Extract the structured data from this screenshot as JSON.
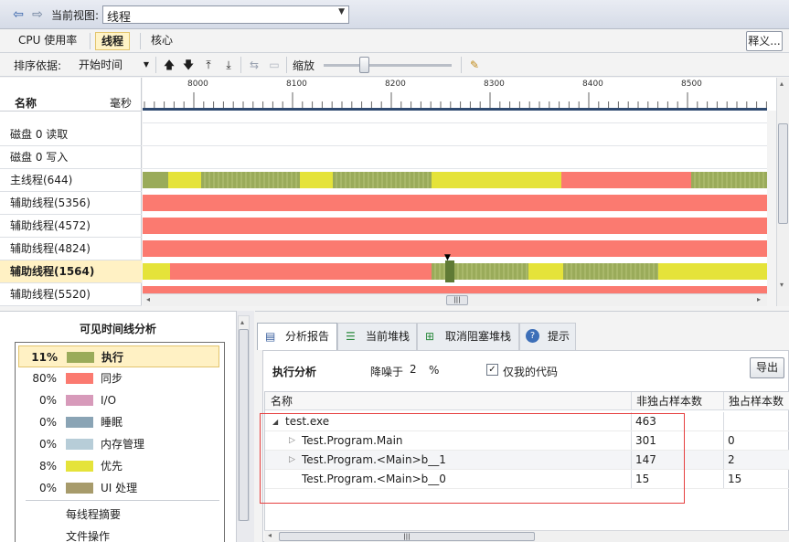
{
  "topbar": {
    "back_icon": "back-arrow-icon",
    "forward_icon": "forward-arrow-icon",
    "view_label": "当前视图:",
    "view_value": "线程"
  },
  "tabs": [
    {
      "label": "CPU 使用率"
    },
    {
      "label": "线程"
    },
    {
      "label": "核心"
    }
  ],
  "notes_button": "释义...",
  "toolbar": {
    "sort_label": "排序依据:",
    "sort_value": "开始时间",
    "zoom_label": "缩放"
  },
  "timeline": {
    "name_header": "名称",
    "ms_header": "毫秒",
    "ticks": [
      "8000",
      "8100",
      "8200",
      "8300",
      "8400",
      "8500"
    ],
    "rows": [
      {
        "label": "磁盘 0 读取"
      },
      {
        "label": "磁盘 0 写入"
      },
      {
        "label": "主线程(644)"
      },
      {
        "label": "辅助线程(5356)"
      },
      {
        "label": "辅助线程(4572)"
      },
      {
        "label": "辅助线程(4824)"
      },
      {
        "label": "辅助线程(1564)"
      },
      {
        "label": "辅助线程(5520)"
      }
    ]
  },
  "legend": {
    "title": "可见时间线分析",
    "items": [
      {
        "pct": "11%",
        "label": "执行",
        "color": "#9aab5a"
      },
      {
        "pct": "80%",
        "label": "同步",
        "color": "#fb7a70"
      },
      {
        "pct": "0%",
        "label": "I/O",
        "color": "#d79aba"
      },
      {
        "pct": "0%",
        "label": "睡眠",
        "color": "#8aa4b5"
      },
      {
        "pct": "0%",
        "label": "内存管理",
        "color": "#b7cdd8"
      },
      {
        "pct": "8%",
        "label": "优先",
        "color": "#e5e33a"
      },
      {
        "pct": "0%",
        "label": "UI 处理",
        "color": "#a79b6b"
      }
    ],
    "links": [
      "每线程摘要",
      "文件操作"
    ]
  },
  "bottom_tabs": [
    {
      "label": "分析报告",
      "icon": "report-icon"
    },
    {
      "label": "当前堆栈",
      "icon": "stack-icon"
    },
    {
      "label": "取消阻塞堆栈",
      "icon": "unblock-stack-icon"
    },
    {
      "label": "提示",
      "icon": "help-icon"
    }
  ],
  "report": {
    "title": "执行分析",
    "noise_label": "降噪于",
    "noise_value": "2",
    "noise_unit": "%",
    "my_code_label": "仅我的代码",
    "export_button": "导出",
    "columns": [
      "名称",
      "非独占样本数",
      "独占样本数"
    ],
    "rows": [
      {
        "name": "test.exe",
        "inclusive": "463",
        "exclusive": ""
      },
      {
        "name": "Test.Program.Main",
        "inclusive": "301",
        "exclusive": "0"
      },
      {
        "name": "Test.Program.<Main>b__1",
        "inclusive": "147",
        "exclusive": "2"
      },
      {
        "name": "Test.Program.<Main>b__0",
        "inclusive": "15",
        "exclusive": "15"
      }
    ]
  }
}
